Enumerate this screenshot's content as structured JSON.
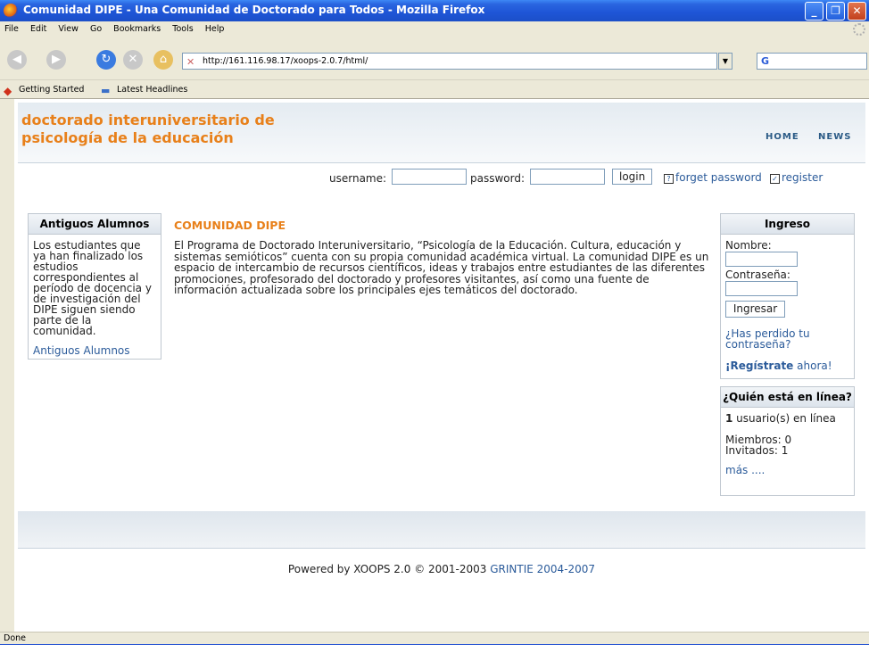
{
  "window": {
    "title": "Comunidad DIPE - Una Comunidad de Doctorado para Todos - Mozilla Firefox"
  },
  "menu": [
    "File",
    "Edit",
    "View",
    "Go",
    "Bookmarks",
    "Tools",
    "Help"
  ],
  "toolbar": {
    "url": "http://161.116.98.17/xoops-2.0.7/html/",
    "search_engine": "G"
  },
  "bookmarks": {
    "getting_started": "Getting Started",
    "latest_headlines": "Latest Headlines"
  },
  "site": {
    "name_line1": "doctorado interuniversitario de",
    "name_line2": "psicología de la educación",
    "nav_home": "HOME",
    "nav_news": "NEWS"
  },
  "login": {
    "username_label": "username:",
    "password_label": "password:",
    "login_button": "login",
    "forget_password": "forget password",
    "register": "register"
  },
  "left_block": {
    "title": "Antiguos Alumnos",
    "text": "Los estudiantes que ya han finalizado los estudios correspondientes al período de docencia y de investigación del DIPE siguen siendo parte de la comunidad.",
    "link": "Antiguos Alumnos"
  },
  "center": {
    "title": "COMUNIDAD DIPE",
    "body": "El Programa de Doctorado Interuniversitario, “Psicología de la Educación. Cultura, educación y sistemas semióticos” cuenta con su propia comunidad académica virtual. La comunidad DIPE es un espacio de intercambio de recursos científicos, ideas y trabajos entre estudiantes de las diferentes promociones, profesorado del doctorado y profesores visitantes, así como una fuente de información actualizada sobre los principales ejes temáticos del doctorado."
  },
  "ingreso": {
    "title": "Ingreso",
    "nombre": "Nombre:",
    "contrasena": "Contraseña:",
    "button": "Ingresar",
    "lost_password": "¿Has perdido tu contraseña?",
    "register_bold": "¡Regístrate",
    "register_rest": " ahora!"
  },
  "online": {
    "title": "¿Quién está en línea?",
    "count": "1",
    "count_text": " usuario(s) en línea",
    "members": "Miembros: 0",
    "guests": "Invitados: 1",
    "more": "más ...."
  },
  "footer": {
    "powered": "Powered by XOOPS 2.0 © 2001-2003 ",
    "grintie": "GRINTIE 2004-2007"
  },
  "status": "Done",
  "colors": {
    "accent_orange": "#e8801a",
    "link_blue": "#2b5b9a"
  }
}
